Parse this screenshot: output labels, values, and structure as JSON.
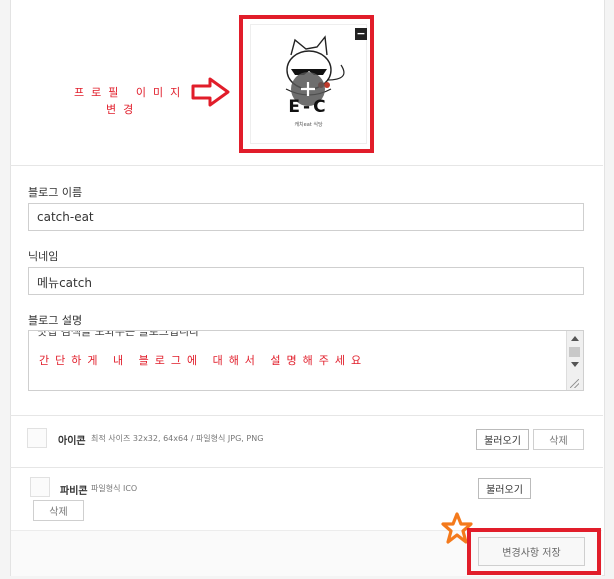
{
  "profile": {
    "annotation_line1": "프로필 이미지",
    "annotation_line2": "변경",
    "image_title": "E-C",
    "image_subtitle": "캐치eat 식당",
    "remove_button_label": "−"
  },
  "blog_name": {
    "label": "블로그 이름",
    "value": "catch-eat"
  },
  "nickname": {
    "label": "닉네임",
    "value": "메뉴catch"
  },
  "blog_desc": {
    "label": "블로그 설명",
    "partial_text": "맛집 검색을 도와주는 블로그입니다",
    "overlay_text": "간단하게 내 블로그에 대해서 설명해주세요"
  },
  "icon_row": {
    "title": "아이콘",
    "desc": "최적 사이즈 32x32, 64x64 / 파일형식 JPG, PNG",
    "load_label": "불러오기",
    "delete_label": "삭제"
  },
  "favicon_row": {
    "title": "파비콘",
    "desc": "파일형식 ICO",
    "load_label": "불러오기",
    "delete_label": "삭제"
  },
  "save_label": "변경사항 저장",
  "colors": {
    "annotation_red": "#e11d2a",
    "star_orange": "#f47a1c"
  },
  "icons": [
    "arrow-right-icon",
    "cat-logo-icon",
    "star-icon",
    "scroll-up-icon",
    "scroll-down-icon",
    "resize-grip-icon"
  ]
}
